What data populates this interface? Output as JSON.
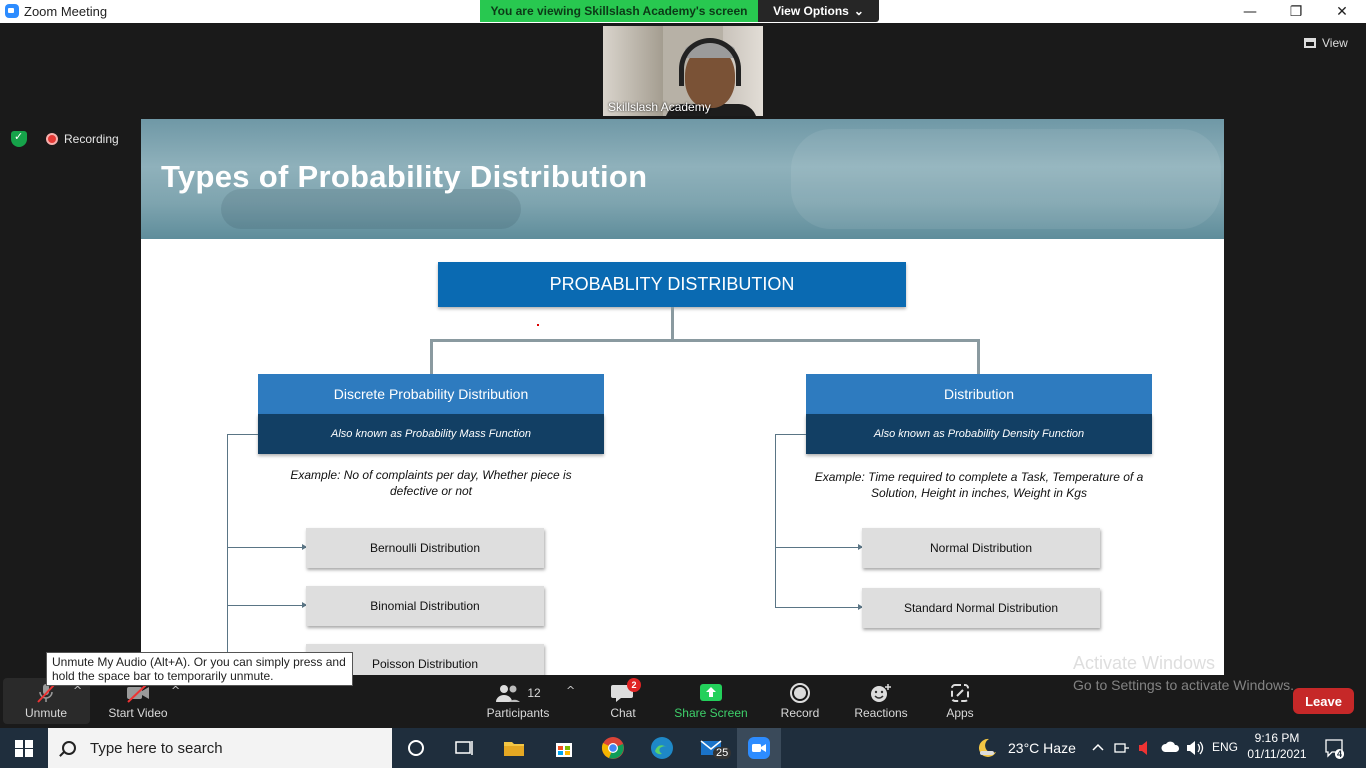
{
  "window": {
    "title": "Zoom Meeting",
    "minimize": "—",
    "restore": "❐",
    "close": "✕"
  },
  "share_banner": {
    "text": "You are viewing Skillslash Academy's screen",
    "view_options": "View Options",
    "chevron": "⌄"
  },
  "participant_video": {
    "name": "Skillslash Academy"
  },
  "view_button": {
    "label": "View"
  },
  "recording": {
    "label": "Recording"
  },
  "slide": {
    "title": "Types of Probability Distribution",
    "root_label": "PROBABLITY DISTRIBUTION",
    "left": {
      "title": "Discrete Probability Distribution",
      "subtitle": "Also known as Probability Mass Function",
      "example": "Example: No of complaints per day, Whether piece is defective or not",
      "items": [
        "Bernoulli Distribution",
        "Binomial Distribution",
        "Poisson Distribution"
      ]
    },
    "right": {
      "title": "Distribution",
      "subtitle": "Also known as Probability Density Function",
      "example": "Example: Time required to complete a Task, Temperature of a Solution, Height in inches, Weight in Kgs",
      "items": [
        "Normal Distribution",
        "Standard Normal Distribution"
      ]
    }
  },
  "tooltip": {
    "line1": "Unmute My Audio (Alt+A). Or you can simply press and",
    "line2": "hold the space bar to temporarily unmute."
  },
  "watermark": {
    "line1": "Activate Windows",
    "line2": "Go to Settings to activate Windows."
  },
  "toolbar": {
    "unmute": "Unmute",
    "start_video": "Start Video",
    "participants": "Participants",
    "participants_count": "12",
    "chat": "Chat",
    "chat_badge": "2",
    "share_screen": "Share Screen",
    "record": "Record",
    "reactions": "Reactions",
    "apps": "Apps",
    "leave": "Leave",
    "caret": "^"
  },
  "taskbar": {
    "search_placeholder": "Type here to search",
    "mail_badge": "25",
    "weather": "23°C  Haze",
    "language": "ENG",
    "time": "9:16 PM",
    "date": "01/11/2021",
    "notification_count": "4"
  },
  "colors": {
    "banner_green": "#28c850",
    "root_blue": "#0a6ab2",
    "category_blue": "#2e7bbf",
    "category_dark": "#123f64",
    "leave_red": "#c62828",
    "share_green": "#23d05b"
  }
}
